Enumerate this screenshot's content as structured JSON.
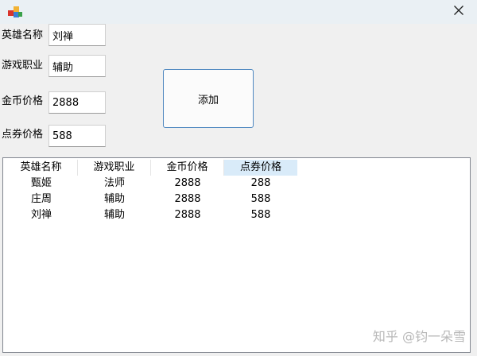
{
  "form": {
    "fields": [
      {
        "label": "英雄名称",
        "value": "刘禅"
      },
      {
        "label": "游戏职业",
        "value": "辅助"
      },
      {
        "label": "金币价格",
        "value": "2888"
      },
      {
        "label": "点券价格",
        "value": "588"
      }
    ],
    "add_button_label": "添加"
  },
  "table": {
    "columns": [
      "英雄名称",
      "游戏职业",
      "金币价格",
      "点券价格"
    ],
    "rows": [
      [
        "甄姬",
        "法师",
        "2888",
        "288"
      ],
      [
        "庄周",
        "辅助",
        "2888",
        "588"
      ],
      [
        "刘禅",
        "辅助",
        "2888",
        "588"
      ]
    ]
  },
  "watermark": "知乎 @钧一朵雪",
  "icons": {
    "app": "app-cube-icon",
    "close": "close-icon"
  }
}
